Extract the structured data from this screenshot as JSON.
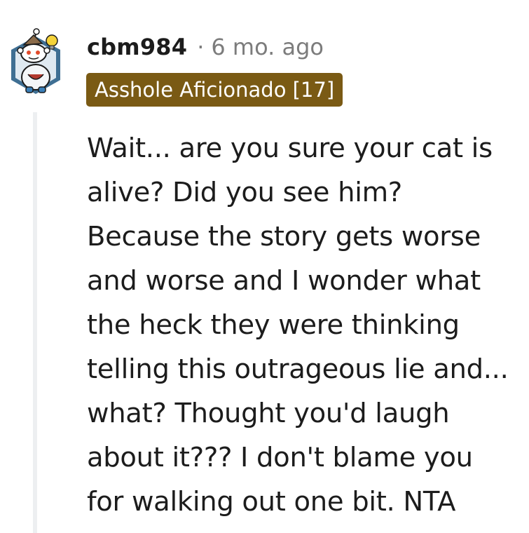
{
  "comment": {
    "author": "cbm984",
    "separator": "·",
    "age": "6 mo. ago",
    "flair": "Asshole Aficionado [17]",
    "body_lines": [
      "Wait... are you sure your cat is",
      "alive? Did you see him?",
      "Because the story gets worse",
      "and worse and I wonder what",
      "the heck they were thinking",
      "telling this outrageous lie and...",
      "what? Thought you'd laugh",
      "about it??? I don't blame you",
      "for walking out one bit. NTA"
    ]
  },
  "colors": {
    "flair_background": "#7a5a14",
    "flair_text": "#ffffff",
    "author_text": "#1c1c1c",
    "meta_text": "#7c7c7c",
    "thread_line": "#edeff1"
  },
  "icons": {
    "avatar": "reddit-snoo-avatar-icon"
  }
}
